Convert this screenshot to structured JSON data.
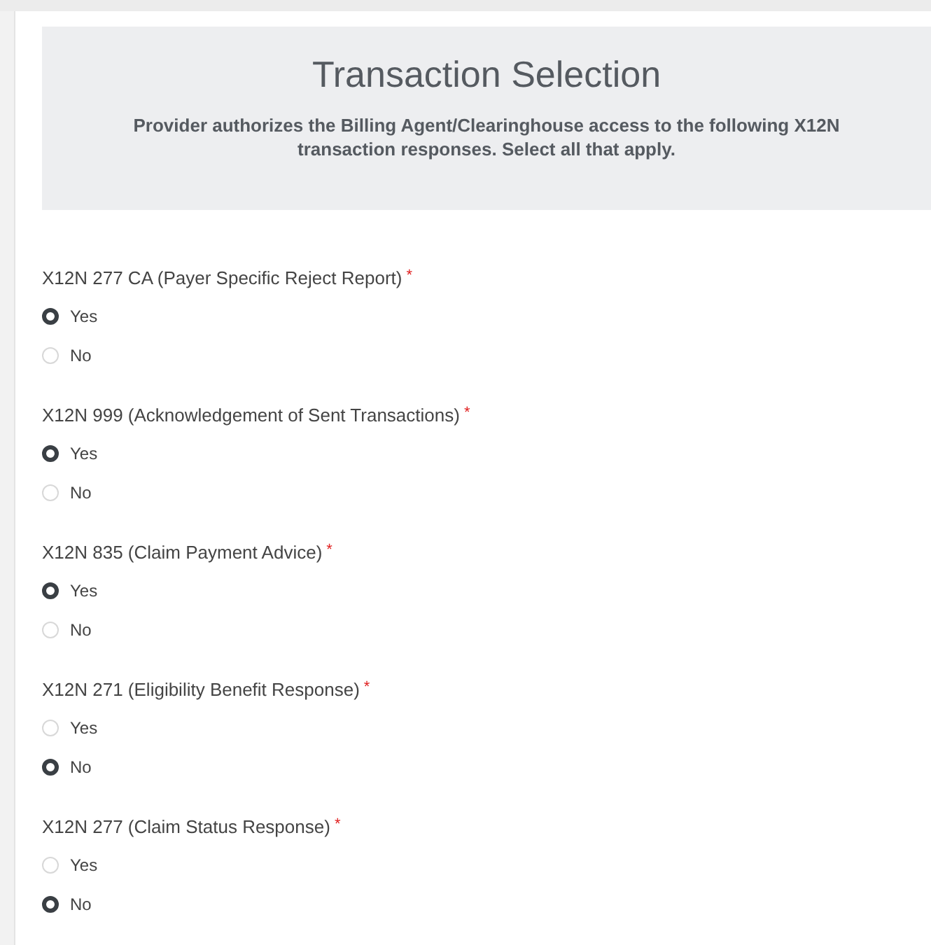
{
  "header": {
    "title": "Transaction Selection",
    "description": "Provider authorizes the Billing Agent/Clearinghouse access to the following X12N transaction responses. Select all that apply."
  },
  "questions": [
    {
      "label": "X12N 277 CA (Payer Specific Reject Report)",
      "required_mark": "*",
      "options": [
        {
          "label": "Yes",
          "selected": true
        },
        {
          "label": "No",
          "selected": false
        }
      ]
    },
    {
      "label": "X12N 999 (Acknowledgement of Sent Transactions)",
      "required_mark": "*",
      "options": [
        {
          "label": "Yes",
          "selected": true
        },
        {
          "label": "No",
          "selected": false
        }
      ]
    },
    {
      "label": "X12N 835 (Claim Payment Advice)",
      "required_mark": "*",
      "options": [
        {
          "label": "Yes",
          "selected": true
        },
        {
          "label": "No",
          "selected": false
        }
      ]
    },
    {
      "label": "X12N 271 (Eligibility Benefit Response)",
      "required_mark": "*",
      "options": [
        {
          "label": "Yes",
          "selected": false
        },
        {
          "label": "No",
          "selected": true
        }
      ]
    },
    {
      "label": "X12N 277 (Claim Status Response)",
      "required_mark": "*",
      "options": [
        {
          "label": "Yes",
          "selected": false
        },
        {
          "label": "No",
          "selected": true
        }
      ]
    }
  ]
}
